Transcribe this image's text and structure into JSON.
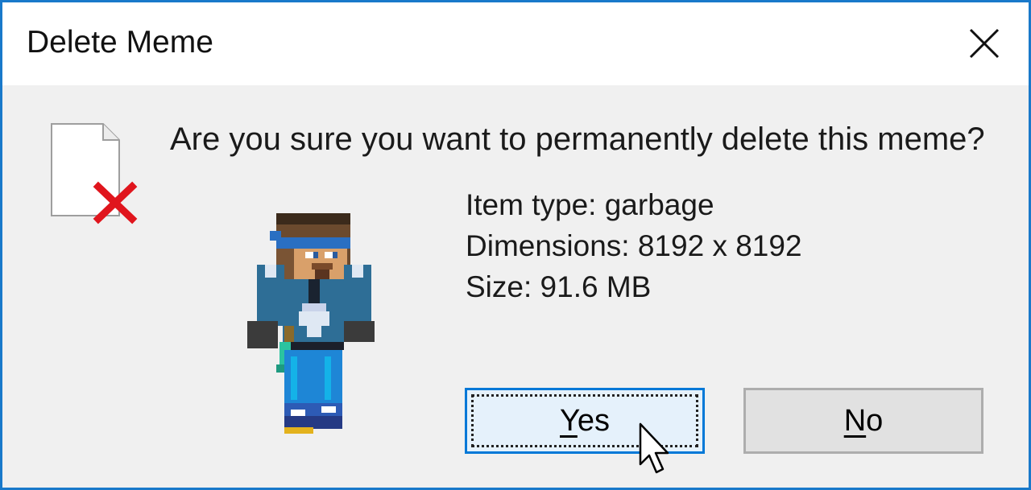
{
  "dialog": {
    "title": "Delete Meme",
    "close_icon": "close-icon",
    "question": "Are you sure you want to permanently delete this meme?",
    "details": [
      "Item type: garbage",
      "Dimensions: 8192 x 8192",
      "Size: 91.6 MB"
    ],
    "icon": "file-delete-icon",
    "illustration": "minecraft-character"
  },
  "buttons": {
    "yes": {
      "mnemonic": "Y",
      "rest": "es"
    },
    "no": {
      "mnemonic": "N",
      "rest": "o"
    }
  },
  "colors": {
    "border": "#1979ca",
    "titlebar": "#ffffff",
    "body": "#f0f0f0",
    "default_button_fill": "#e5f1fb",
    "default_button_border": "#0078d7",
    "button_fill": "#e1e1e1",
    "button_border": "#adadad",
    "delete_x": "#e0151d"
  }
}
